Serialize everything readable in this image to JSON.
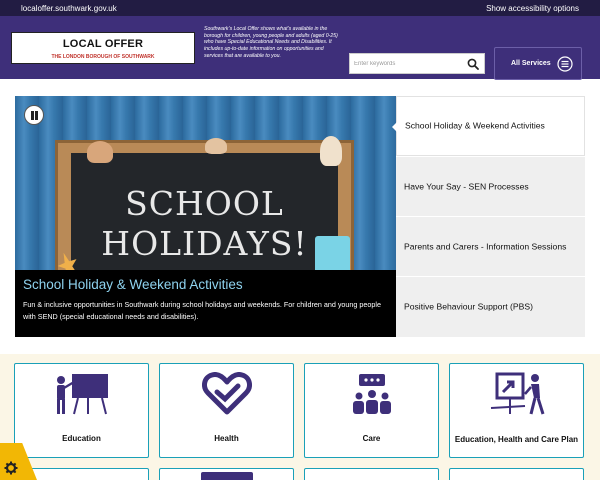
{
  "topbar": {
    "url": "localoffer.southwark.gov.uk",
    "accessibility": "Show accessibility options"
  },
  "header": {
    "logo_title": "LOCAL OFFER",
    "logo_subtitle": "THE LONDON BOROUGH OF SOUTHWARK",
    "intro": "Southwark’s Local Offer shows what’s available in the borough for children, young people and adults (aged 0-25) who have Special Educational Needs and Disabilities. It includes up-to-date information on opportunities and services that are available to you.",
    "search_placeholder": "Enter keywords",
    "search_icon": "search-icon",
    "all_services_label": "All Services",
    "menu_icon": "hamburger-circle-icon"
  },
  "hero": {
    "chalk_line1": "SCHOOL",
    "chalk_line2": "HOLIDAYS!",
    "title": "School Holiday & Weekend Activities",
    "description": "Fun & inclusive opportunities in Southwark during school holidays and weekends. For children and young people with SEND (special educational needs and disabilities).",
    "pause_icon": "pause-icon"
  },
  "slide_tabs": [
    {
      "label": "School Holiday & Weekend Activities",
      "active": true
    },
    {
      "label": "Have Your Say - SEN Processes",
      "active": false
    },
    {
      "label": "Parents and Carers - Information Sessions",
      "active": false
    },
    {
      "label": "Positive Behaviour Support (PBS)",
      "active": false
    }
  ],
  "services": [
    {
      "label": "Education",
      "icon": "teacher-board-icon"
    },
    {
      "label": "Health",
      "icon": "heart-icon"
    },
    {
      "label": "Care",
      "icon": "people-chat-icon"
    },
    {
      "label": "Education, Health and Care Plan",
      "icon": "presentation-walker-icon"
    }
  ],
  "colors": {
    "brand_purple": "#3e2f7a",
    "topbar": "#221c43",
    "accent_teal": "#1aa0b8",
    "hero_title": "#8fd3ef",
    "cookie_yellow": "#f2b705"
  },
  "cookie_icon": "gear-icon"
}
